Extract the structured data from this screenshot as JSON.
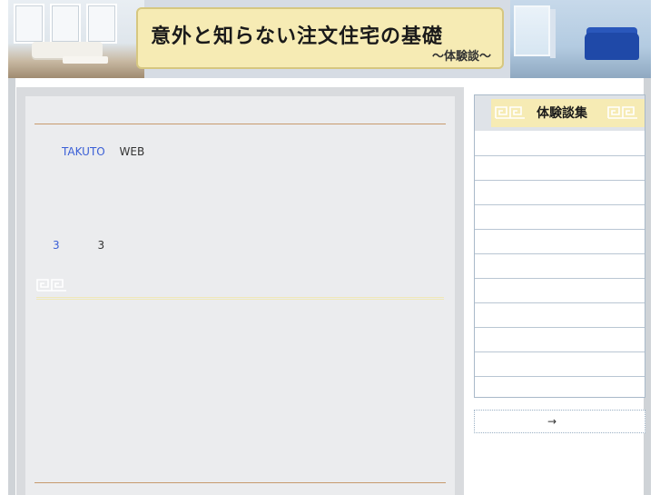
{
  "header": {
    "title": "意外と知らない注文住宅の基礎",
    "subtitle": "～体験談～"
  },
  "main": {
    "author_link": "TAKUTO",
    "author_suffix": "WEB",
    "count_link": "3",
    "count_value": "3"
  },
  "sidebar": {
    "heading": "体験談集",
    "item_count_rows": 10,
    "more_arrow": "→"
  },
  "colors": {
    "banner_yellow": "#f6ebb4",
    "link_blue": "#3a5fd6",
    "rule_orange": "#c79a6e",
    "frame_gray": "#cfd3d7"
  },
  "icons": {
    "section": "greek-key-icon",
    "sidebar": "greek-key-icon"
  }
}
